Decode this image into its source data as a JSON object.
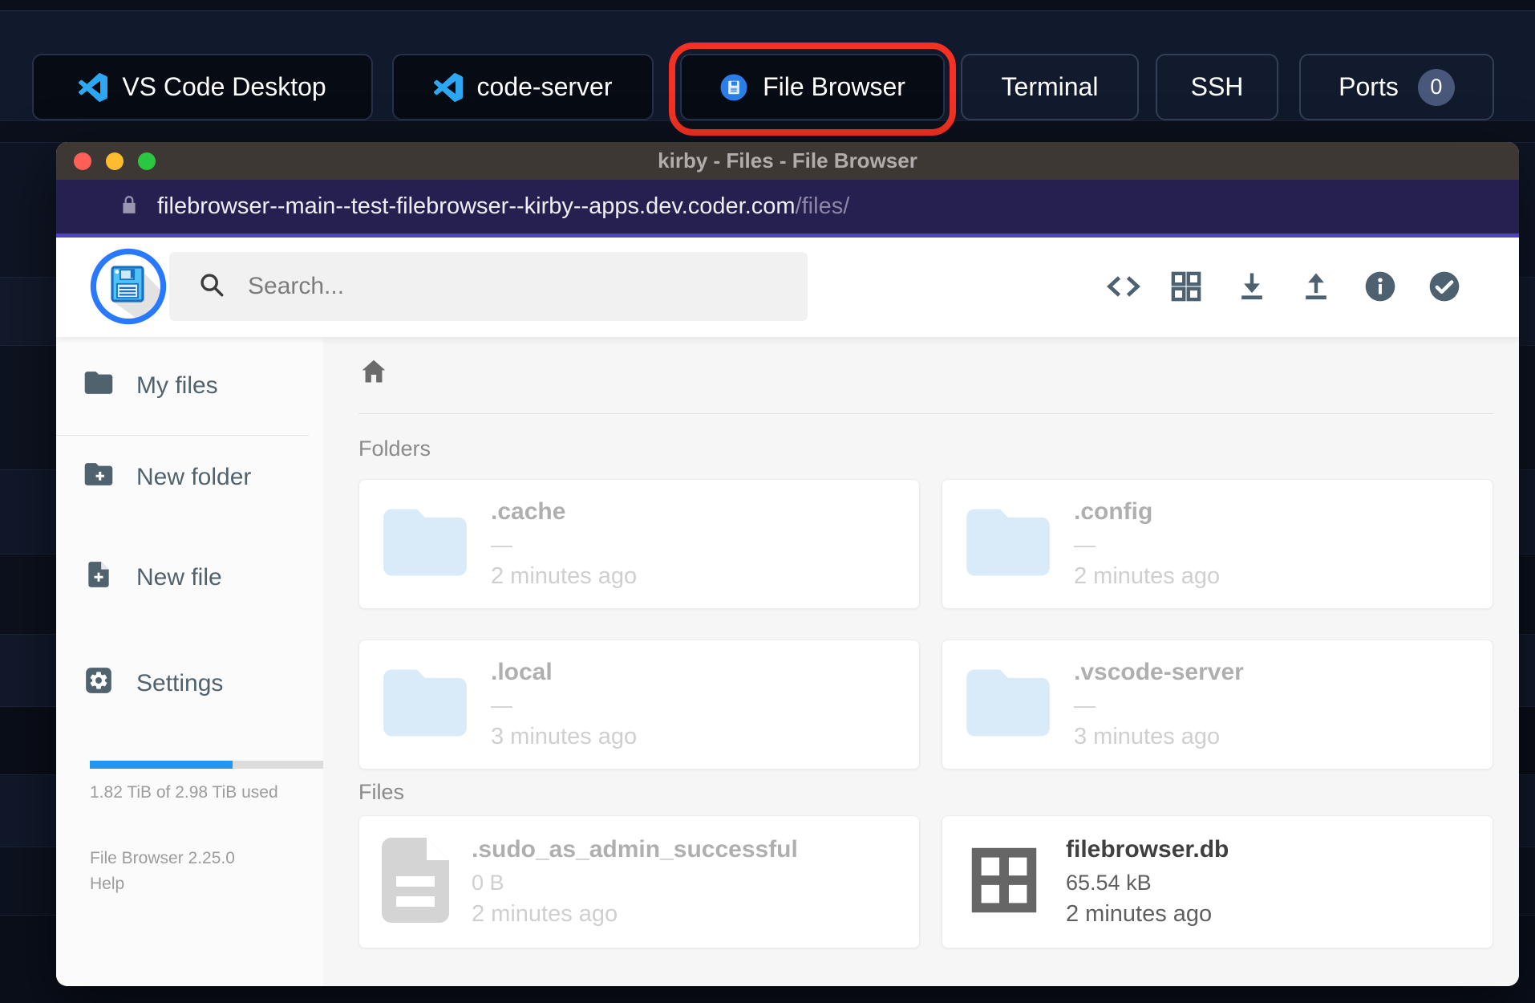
{
  "topbar": {
    "tabs": [
      {
        "label": "VS Code Desktop"
      },
      {
        "label": "code-server"
      },
      {
        "label": "File Browser"
      },
      {
        "label": "Terminal"
      },
      {
        "label": "SSH"
      },
      {
        "label": "Ports",
        "badge": "0"
      }
    ],
    "highlighted_tab": "File Browser"
  },
  "window": {
    "title": "kirby - Files - File Browser",
    "url": {
      "host": "filebrowser--main--test-filebrowser--kirby--apps.dev.coder.com",
      "path": "/files/"
    }
  },
  "app": {
    "search": {
      "placeholder": "Search..."
    },
    "toolbar": {
      "icons": [
        "code-view",
        "grid-view",
        "download",
        "upload",
        "info",
        "select-all"
      ]
    },
    "sidebar": {
      "items": [
        {
          "label": "My files"
        },
        {
          "label": "New folder"
        },
        {
          "label": "New file"
        },
        {
          "label": "Settings"
        }
      ],
      "storage": {
        "used_percent": 61,
        "label": "1.82 TiB of 2.98 TiB used"
      },
      "version": "File Browser 2.25.0",
      "help_label": "Help"
    },
    "content": {
      "sections": [
        {
          "heading": "Folders",
          "items": [
            {
              "name": ".cache",
              "size": "—",
              "modified": "2 minutes ago"
            },
            {
              "name": ".config",
              "size": "—",
              "modified": "2 minutes ago"
            },
            {
              "name": ".local",
              "size": "—",
              "modified": "3 minutes ago"
            },
            {
              "name": ".vscode-server",
              "size": "—",
              "modified": "3 minutes ago"
            }
          ]
        },
        {
          "heading": "Files",
          "items": [
            {
              "name": ".sudo_as_admin_successful",
              "size": "0 B",
              "modified": "2 minutes ago"
            },
            {
              "name": "filebrowser.db",
              "size": "65.54 kB",
              "modified": "2 minutes ago"
            }
          ]
        }
      ]
    }
  },
  "colors": {
    "accent_blue": "#2196f3",
    "highlight_red": "#f43122",
    "folder_icon_blue": "#a6cef3",
    "url_bar_purple": "#262051",
    "titlebar_brown": "#3e3835"
  }
}
